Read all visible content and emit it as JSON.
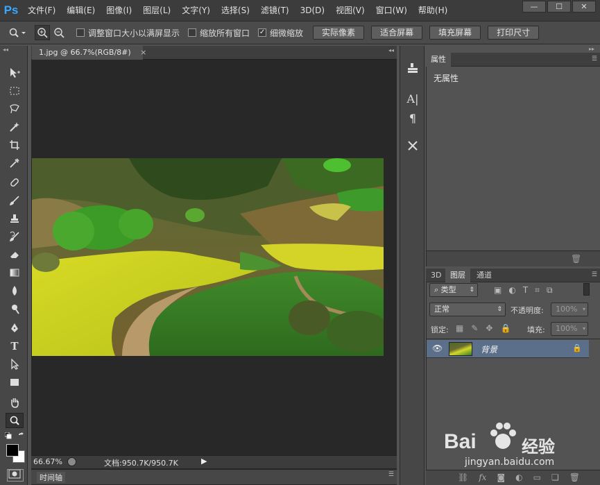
{
  "app": {
    "logo": "Ps"
  },
  "menu": [
    "文件(F)",
    "编辑(E)",
    "图像(I)",
    "图层(L)",
    "文字(Y)",
    "选择(S)",
    "滤镜(T)",
    "3D(D)",
    "视图(V)",
    "窗口(W)",
    "帮助(H)"
  ],
  "window_controls": {
    "minimize": "—",
    "maximize": "☐",
    "close": "✕"
  },
  "options": {
    "resize_windows": "调整窗口大小以满屏显示",
    "zoom_all": "缩放所有窗口",
    "scrubby_zoom": "细微缩放",
    "actual_pixels": "实际像素",
    "fit_screen": "适合屏幕",
    "fill_screen": "填充屏幕",
    "print_size": "打印尺寸",
    "scrubby_checked": true
  },
  "document": {
    "tab_title": "1.jpg @ 66.7%(RGB/8#)",
    "tab_close": "×"
  },
  "status": {
    "zoom": "66.67%",
    "doc_size": "文档:950.7K/950.7K"
  },
  "timeline": {
    "label": "时间轴"
  },
  "properties": {
    "tab": "属性",
    "empty_text": "无属性"
  },
  "layers": {
    "tabs": [
      "3D",
      "图层",
      "通道"
    ],
    "filter_kind": "类型",
    "blend_mode": "正常",
    "opacity_label": "不透明度:",
    "opacity_value": "100%",
    "lock_label": "锁定:",
    "fill_label": "填充:",
    "fill_value": "100%",
    "layer_name": "背景"
  },
  "watermark": {
    "brand": "Bai",
    "brand2": "经验",
    "url": "jingyan.baidu.com"
  }
}
